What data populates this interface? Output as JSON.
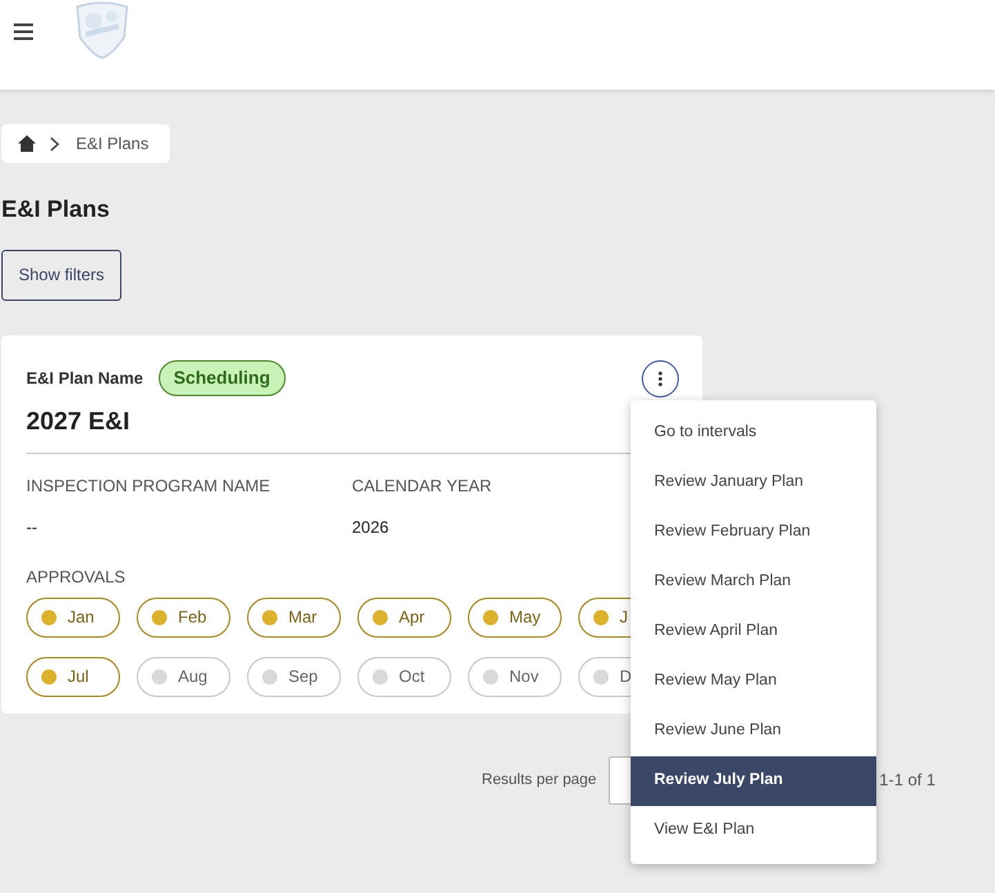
{
  "breadcrumb": {
    "current": "E&I Plans"
  },
  "page_title": "E&I Plans",
  "filters_button": "Show filters",
  "plan_card": {
    "name_label": "E&I Plan Name",
    "status": "Scheduling",
    "name": "2027 E&I",
    "fields": [
      {
        "label": "INSPECTION PROGRAM NAME",
        "value": "--"
      },
      {
        "label": "CALENDAR YEAR",
        "value": "2026"
      }
    ],
    "approvals_label": "APPROVALS",
    "approvals": [
      {
        "month": "Jan",
        "approved": true
      },
      {
        "month": "Feb",
        "approved": true
      },
      {
        "month": "Mar",
        "approved": true
      },
      {
        "month": "Apr",
        "approved": true
      },
      {
        "month": "May",
        "approved": true
      },
      {
        "month": "J",
        "approved": true
      },
      {
        "month": "Jul",
        "approved": true
      },
      {
        "month": "Aug",
        "approved": false
      },
      {
        "month": "Sep",
        "approved": false
      },
      {
        "month": "Oct",
        "approved": false
      },
      {
        "month": "Nov",
        "approved": false
      },
      {
        "month": "D",
        "approved": false
      }
    ]
  },
  "menu": [
    {
      "label": "Go to intervals",
      "selected": false
    },
    {
      "label": "Review January Plan",
      "selected": false
    },
    {
      "label": "Review February Plan",
      "selected": false
    },
    {
      "label": "Review March Plan",
      "selected": false
    },
    {
      "label": "Review April Plan",
      "selected": false
    },
    {
      "label": "Review May Plan",
      "selected": false
    },
    {
      "label": "Review June Plan",
      "selected": false
    },
    {
      "label": "Review July Plan",
      "selected": true
    },
    {
      "label": "View E&I Plan",
      "selected": false
    }
  ],
  "pagination": {
    "results_label": "Results per page",
    "range": "1-1 of 1"
  }
}
